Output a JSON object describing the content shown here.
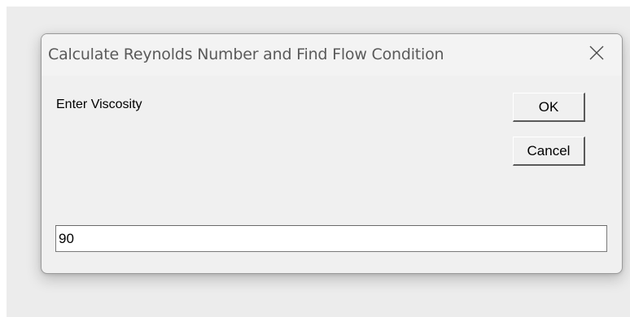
{
  "dialog": {
    "title": "Calculate Reynolds Number and Find Flow Condition",
    "close_icon": "close-icon",
    "prompt": "Enter Viscosity",
    "ok_label": "OK",
    "cancel_label": "Cancel",
    "input_value": "90"
  },
  "colors": {
    "dialog_bg": "#f0f0f0",
    "title_text": "#5a5a5a",
    "input_bg": "#ffffff"
  }
}
